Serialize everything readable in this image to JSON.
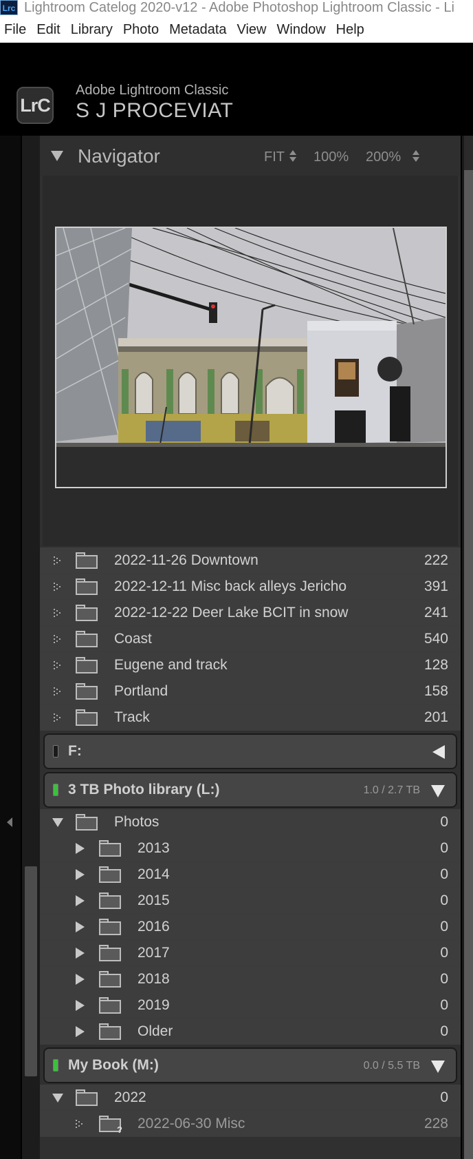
{
  "window": {
    "icon_label": "Lrc",
    "title": "Lightroom Catelog 2020-v12 - Adobe Photoshop Lightroom Classic - Li"
  },
  "menu": [
    "File",
    "Edit",
    "Library",
    "Photo",
    "Metadata",
    "View",
    "Window",
    "Help"
  ],
  "identity": {
    "logo_text": "LrC",
    "app_name": "Adobe Lightroom Classic",
    "user_name": "S J PROCEVIAT"
  },
  "navigator": {
    "title": "Navigator",
    "zoom_fit": "FIT",
    "zoom_100": "100%",
    "zoom_200": "200%"
  },
  "folders_top": [
    {
      "name": "2022-11-26  Downtown",
      "count": "222"
    },
    {
      "name": "2022-12-11  Misc back alleys Jericho",
      "count": "391"
    },
    {
      "name": "2022-12-22  Deer Lake BCIT in snow",
      "count": "241"
    },
    {
      "name": "Coast",
      "count": "540"
    },
    {
      "name": "Eugene and track",
      "count": "128"
    },
    {
      "name": "Portland",
      "count": "158"
    },
    {
      "name": "Track",
      "count": "201"
    }
  ],
  "volume_f": {
    "name": "F:",
    "led_color": "#1a1a1a"
  },
  "volume_l": {
    "name": "3 TB Photo library (L:)",
    "capacity": "1.0 / 2.7 TB",
    "led_color": "#3fbf3f"
  },
  "photos_root": {
    "name": "Photos",
    "count": "0"
  },
  "photos_years": [
    {
      "name": "2013",
      "count": "0"
    },
    {
      "name": "2014",
      "count": "0"
    },
    {
      "name": "2015",
      "count": "0"
    },
    {
      "name": "2016",
      "count": "0"
    },
    {
      "name": "2017",
      "count": "0"
    },
    {
      "name": "2018",
      "count": "0"
    },
    {
      "name": "2019",
      "count": "0"
    },
    {
      "name": "Older",
      "count": "0"
    }
  ],
  "volume_m": {
    "name": "My Book (M:)",
    "capacity": "0.0 / 5.5 TB",
    "led_color": "#3fbf3f"
  },
  "m_root": {
    "name": "2022",
    "count": "0"
  },
  "m_child": {
    "name": "2022-06-30  Misc",
    "count": "228"
  }
}
